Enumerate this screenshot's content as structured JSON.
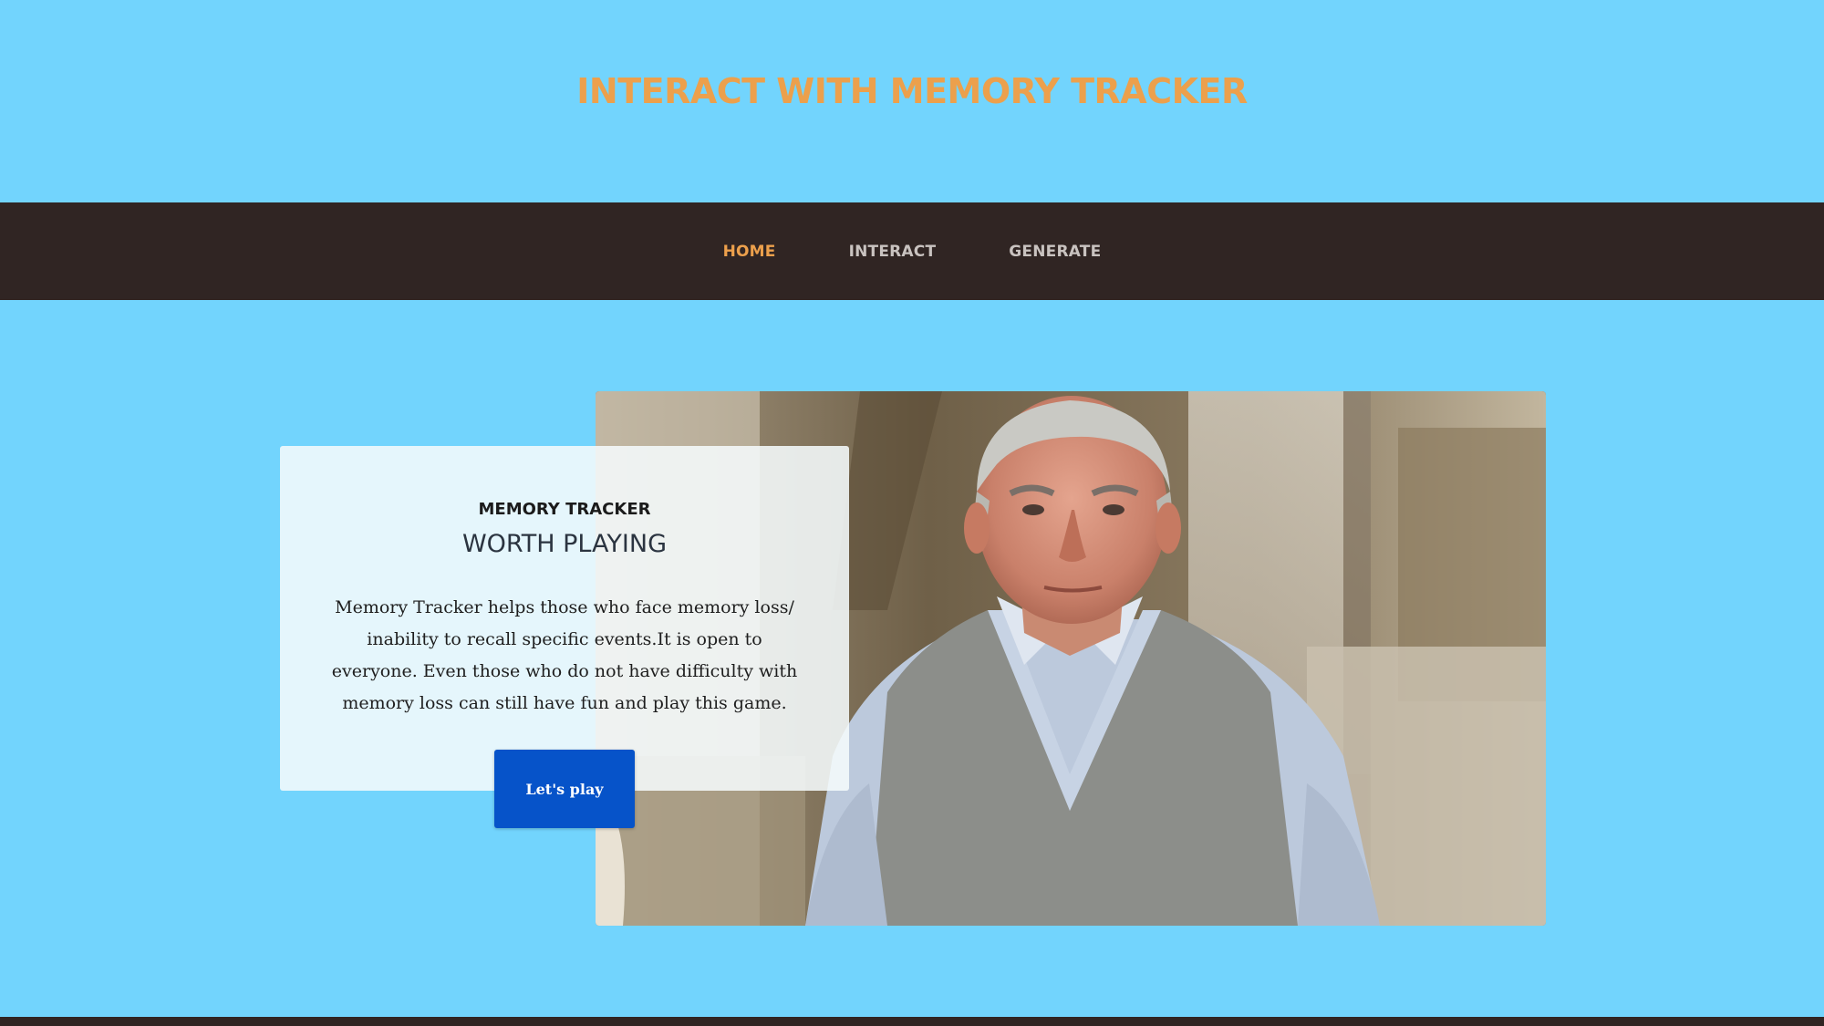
{
  "header": {
    "title": "INTERACT WITH MEMORY TRACKER"
  },
  "nav": {
    "items": [
      {
        "label": "HOME",
        "active": true
      },
      {
        "label": "INTERACT",
        "active": false
      },
      {
        "label": "GENERATE",
        "active": false
      }
    ]
  },
  "hero": {
    "image_subject": "elderly-man-portrait",
    "card": {
      "eyebrow": "MEMORY TRACKER",
      "heading": "WORTH PLAYING",
      "body": "Memory Tracker helps those who face memory loss/ inability to recall specific events.It is open to everyone. Even those who do not have difficulty with memory loss can still have fun and play this game."
    },
    "button_label": "Let's play"
  },
  "colors": {
    "background": "#72d4fd",
    "accent": "#eca04c",
    "nav_background": "#302523",
    "nav_text": "#c9c3c0",
    "button": "#0653c9"
  }
}
